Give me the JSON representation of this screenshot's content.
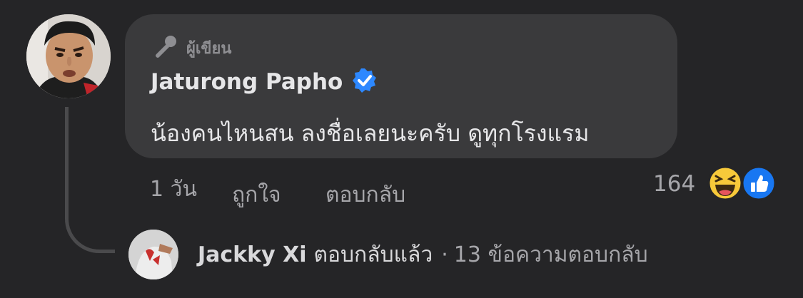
{
  "comment": {
    "author_badge": "ผู้เขียน",
    "author_name": "Jaturong Papho",
    "verified_icon": "verified-badge-icon",
    "text": "น้องคนไหนสน ลงชื่อเลยนะครับ ดูทุกโรงแรม",
    "time": "1 วัน",
    "like_label": "ถูกใจ",
    "reply_label": "ตอบกลับ",
    "reaction_count": "164",
    "reactions": [
      "haha-icon",
      "like-icon"
    ]
  },
  "reply_summary": {
    "name": "Jackky Xi",
    "action": "ตอบกลับแล้ว",
    "separator": "·",
    "count_text": "13 ข้อความตอบกลับ"
  },
  "colors": {
    "background": "#252527",
    "bubble": "#3a3a3c",
    "verified": "#2d88ff",
    "like_blue": "#1877f2",
    "haha_yellow": "#f7c93a"
  }
}
